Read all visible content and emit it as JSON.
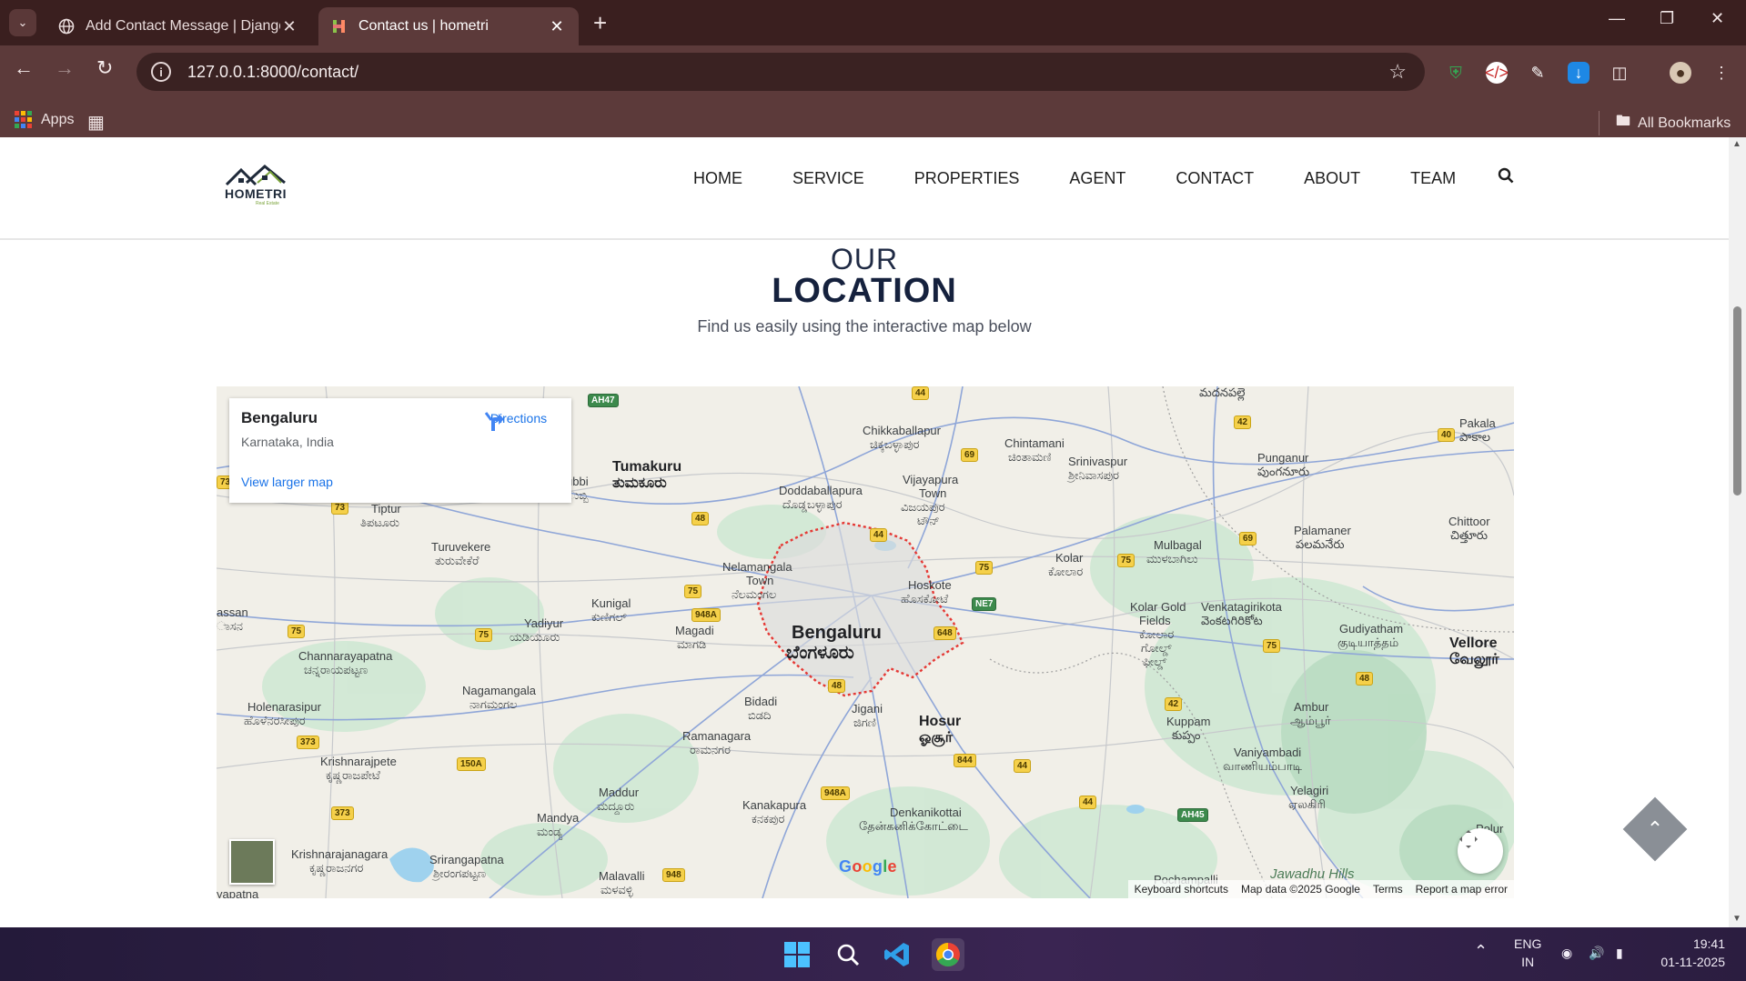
{
  "browser": {
    "tabs": [
      {
        "title": "Add Contact Message | Django",
        "active": false
      },
      {
        "title": "Contact us | hometri",
        "active": true
      }
    ],
    "url": "127.0.0.1:8000/contact/",
    "bookmarks": {
      "apps_label": "Apps",
      "all_bookmarks_label": "All Bookmarks"
    }
  },
  "site": {
    "logo_text": "HOMETRI",
    "logo_sub": "Real Estate",
    "menu": [
      "HOME",
      "SERVICE",
      "PROPERTIES",
      "AGENT",
      "CONTACT",
      "ABOUT",
      "TEAM"
    ]
  },
  "section": {
    "kicker": "OUR",
    "title": "LOCATION",
    "subtitle": "Find us easily using the interactive map below"
  },
  "map": {
    "place_name": "Bengaluru",
    "place_region": "Karnataka, India",
    "directions_label": "Directions",
    "view_larger_label": "View larger map",
    "google_logo": "Google",
    "attribution": {
      "shortcuts": "Keyboard shortcuts",
      "data": "Map data ©2025 Google",
      "terms": "Terms",
      "report": "Report a map error"
    },
    "labels": {
      "bengaluru_en": "Bengaluru",
      "bengaluru_kn": "ಬೆಂಗಳೂರು",
      "tumakuru_en": "Tumakuru",
      "tumakuru_kn": "ತುಮಕೂರು",
      "chikkaballapur_en": "Chikkaballapur",
      "chikkaballapur_kn": "ಚಿಕ್ಕಬಳ್ಳಾಪುರ",
      "chintamani_en": "Chintamani",
      "chintamani_kn": "ಚಿಂತಾಮಣಿ",
      "srinivaspur_en": "Srinivaspur",
      "srinivaspur_kn": "ಶ್ರೀನಿವಾಸಪುರ",
      "punganur_en": "Punganur",
      "punganur_ta": "పుంగనూరు",
      "pakala_en": "Pakala",
      "pakala_te": "పాకాల",
      "madanapalle_te": "మదనపల్లె",
      "doddaballapura_en": "Doddaballapura",
      "doddaballapura_kn": "ದೊಡ್ಡಬಳ್ಳಾಪುರ",
      "vijayapura_en": "Vijayapura",
      "vijayapura_en2": "Town",
      "vijayapura_kn": "ವಿಜಯಪುರ",
      "vijayapura_kn2": "ಟೌನ್",
      "tiptur_en": "Tiptur",
      "tiptur_kn": "ತಿಪಟೂರು",
      "turuvekere_en": "Turuvekere",
      "turuvekere_kn": "ತುರುವೇಕೆರೆ",
      "kolar_en": "Kolar",
      "kolar_kn": "ಕೋಲಾರ",
      "mulbagal_en": "Mulbagal",
      "mulbagal_kn": "ಮುಳಬಾಗಿಲು",
      "palamaner_en": "Palamaner",
      "palamaner_te": "పలమనేరు",
      "chittoor_en": "Chittoor",
      "chittoor_te": "చిత్తూరు",
      "nelamangala_en": "Nelamangala",
      "nelamangala_en2": "Town",
      "nelamangala_kn": "ನೆಲಮಂಗಲ",
      "hoskote_en": "Hoskote",
      "hoskote_kn": "ಹೊಸಕೋಟೆ",
      "kunigal_en": "Kunigal",
      "kunigal_kn": "ಕುಣಿಗಲ್",
      "yadiyur_en": "Yadiyur",
      "yadiyur_kn": "ಯಡಿಯೂರು",
      "assan_en": "assan",
      "assan_kn": "ಾಸನ",
      "kgf_en": "Kolar Gold",
      "kgf_en2": "Fields",
      "kgf_kn": "ಕೋಲಾರ",
      "kgf_kn2": "ಗೋಲ್ಡ್",
      "kgf_kn3": "ಫೀಲ್ಡ್",
      "venkatagirikota_en": "Venkatagirikota",
      "venkatagirikota_te": "వెంకటగిరికోట",
      "gudiyatham_en": "Gudiyatham",
      "gudiyatham_ta": "குடியாத்தம்",
      "vellore_en": "Vellore",
      "vellore_ta": "வேலூர்",
      "channarayapatna_en": "Channarayapatna",
      "channarayapatna_kn": "ಚನ್ನರಾಯಪಟ್ಟಣ",
      "magadi_en": "Magadi",
      "magadi_kn": "ಮಾಗಡಿ",
      "nagamangala_en": "Nagamangala",
      "nagamangala_kn": "ನಾಗಮಂಗಲ",
      "holenarasipur_en": "Holenarasipur",
      "holenarasipur_kn": "ಹೊಳೆನರಸೀಪುರ",
      "bidadi_en": "Bidadi",
      "bidadi_kn": "ಬಿಡದಿ",
      "jigani_en": "Jigani",
      "jigani_kn": "ಜಿಗಣಿ",
      "hosur_en": "Hosur",
      "hosur_ta": "ஓசூர்",
      "ramanagara_en": "Ramanagara",
      "ramanagara_kn": "ರಾಮನಗರ",
      "kuppam_en": "Kuppam",
      "kuppam_te": "కుప్పం",
      "ambur_en": "Ambur",
      "ambur_ta": "ஆம்பூர்",
      "vaniyambadi_en": "Vaniyambadi",
      "vaniyambadi_ta": "வாணியம்பாடி",
      "krishnarajpete_en": "Krishnarajpete",
      "krishnarajpete_kn": "ಕೃಷ್ಣರಾಜಪೇಟೆ",
      "maddur_en": "Maddur",
      "maddur_kn": "ಮದ್ದೂರು",
      "mandya_en": "Mandya",
      "mandya_kn": "ಮಂಡ್ಯ",
      "kanakapura_en": "Kanakapura",
      "kanakapura_kn": "ಕನಕಪುರ",
      "denkanikottai_en": "Denkanikottai",
      "denkanikottai_ta": "தேன்கனிக்கோட்டை",
      "yelagiri_en": "Yelagiri",
      "yelagiri_ta": "ஏலகிரி",
      "krs_en": "Krishnarajanagara",
      "krs_kn": "ಕೃಷ್ಣರಾಜನಗರ",
      "srirangapatna_en": "Srirangapatna",
      "srirangapatna_kn": "ಶ್ರೀರಂಗಪಟ್ಟಣ",
      "malavalli_en": "Malavalli",
      "malavalli_kn": "ಮಳವಳ್ಳಿ",
      "pochampalli_en": "Pochampalli",
      "jawadhu_en": "Jawadhu Hills",
      "ubbi": "ubbi",
      "ubbi_kn": "ುಬ್ಬಿ",
      "yapatna": "yapatna",
      "polur": "Polur"
    },
    "shields": {
      "ah47": "AH47",
      "s44a": "44",
      "s42": "42",
      "s40": "40",
      "s69a": "69",
      "s73": "73",
      "s73b": "73",
      "s48a": "48",
      "s44b": "44",
      "s69b": "69",
      "s75a": "75",
      "s75b": "75",
      "s948a": "948A",
      "ne7": "NE7",
      "s648": "648",
      "s75c": "75",
      "s75d": "75",
      "s75e": "75",
      "s75f": "75",
      "s48b": "48",
      "s48c": "48",
      "s42b": "42",
      "s373": "373",
      "s150a": "150A",
      "s844": "844",
      "s44c": "44",
      "s948a2": "948A",
      "s44d": "44",
      "s373b": "373",
      "ah45": "AH45",
      "s948": "948"
    }
  },
  "scroll_top_icon": "chevron-up-icon",
  "taskbar": {
    "lang_top": "ENG",
    "lang_bottom": "IN",
    "time": "19:41",
    "date": "01-11-2025"
  },
  "colors": {
    "tabbar": "#3a1f1f",
    "toolbar": "#5c3a3a",
    "link_blue": "#1a73e8",
    "city_boundary": "#e53935",
    "heading_navy": "#15213d"
  }
}
